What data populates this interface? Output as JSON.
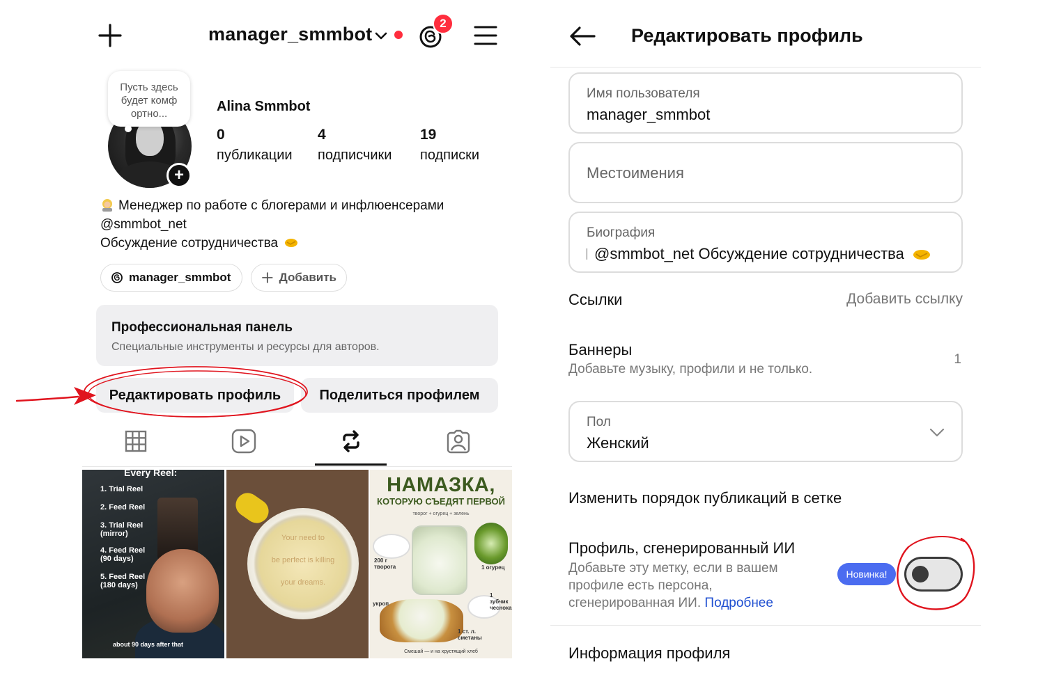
{
  "profile": {
    "username_top": "manager_smmbot",
    "notifications_badge": "2",
    "note_text": "Пусть здесь будет комф ортно...",
    "display_name": "Alina Smmbot",
    "stats": [
      {
        "num": "0",
        "label": "публикации"
      },
      {
        "num": "4",
        "label": "подписчики"
      },
      {
        "num": "19",
        "label": "подписки"
      }
    ],
    "bio_line1": "Менеджер по работе с блогерами и инфлюенсерами",
    "bio_line2": "@smmbot_net",
    "bio_line3": "Обсуждение сотрудничества",
    "threads_pill": "manager_smmbot",
    "add_pill": "Добавить",
    "pro_title": "Профессиональная панель",
    "pro_sub": "Специальные инструменты и ресурсы для авторов.",
    "edit_btn": "Редактировать профиль",
    "share_btn": "Поделиться профилем"
  },
  "tiles": {
    "t1_title": "Every Reel:",
    "t1_steps": [
      "1. Trial Reel",
      "2. Feed Reel",
      "3. Trial Reel (mirror)",
      "4. Feed Reel (90 days)",
      "5. Feed Reel (180 days)"
    ],
    "t1_foot": "about 90 days after that",
    "t2_lines": [
      "Your need to",
      "be perfect is killing",
      "your dreams."
    ],
    "t3_head": "НАМАЗКА,",
    "t3_sub": "КОТОРУЮ СЪЕДЯТ ПЕРВОЙ",
    "t3_tiny": "творог + огурец + зелень",
    "t3_lbl_tvorog": "200 г творога",
    "t3_lbl_ogurec": "1 огурец",
    "t3_lbl_ukrop": "укроп",
    "t3_lbl_chesnok": "1 зубчик чеснока",
    "t3_lbl_smetana": "1 ст. л. сметаны",
    "t3_foot": "Смешай — и на хрустящий хлеб"
  },
  "edit": {
    "title": "Редактировать профиль",
    "username_label": "Имя пользователя",
    "username_value": "manager_smmbot",
    "pronouns_label": "Местоимения",
    "bio_label": "Биография",
    "bio_value": "@smmbot_net Обсуждение сотрудничества",
    "links_label": "Ссылки",
    "links_action": "Добавить ссылку",
    "banners_label": "Баннеры",
    "banners_sub": "Добавьте музыку, профили и не только.",
    "banners_count": "1",
    "gender_label": "Пол",
    "gender_value": "Женский",
    "grid_order": "Изменить порядок публикаций в сетке",
    "ai_title": "Профиль, сгенерированный ИИ",
    "ai_desc": "Добавьте эту метку, если в вашем профиле есть персона, сгенерированная ИИ.",
    "ai_more": "Подробнее",
    "new_badge": "Новинка!",
    "ai_toggle_on": false,
    "profile_info": "Информация профиля"
  },
  "colors": {
    "accent_red": "#ff2d3d",
    "annotation_red": "#e0141e",
    "badge_blue": "#4b6cf0",
    "link_blue": "#1f4fd1"
  }
}
